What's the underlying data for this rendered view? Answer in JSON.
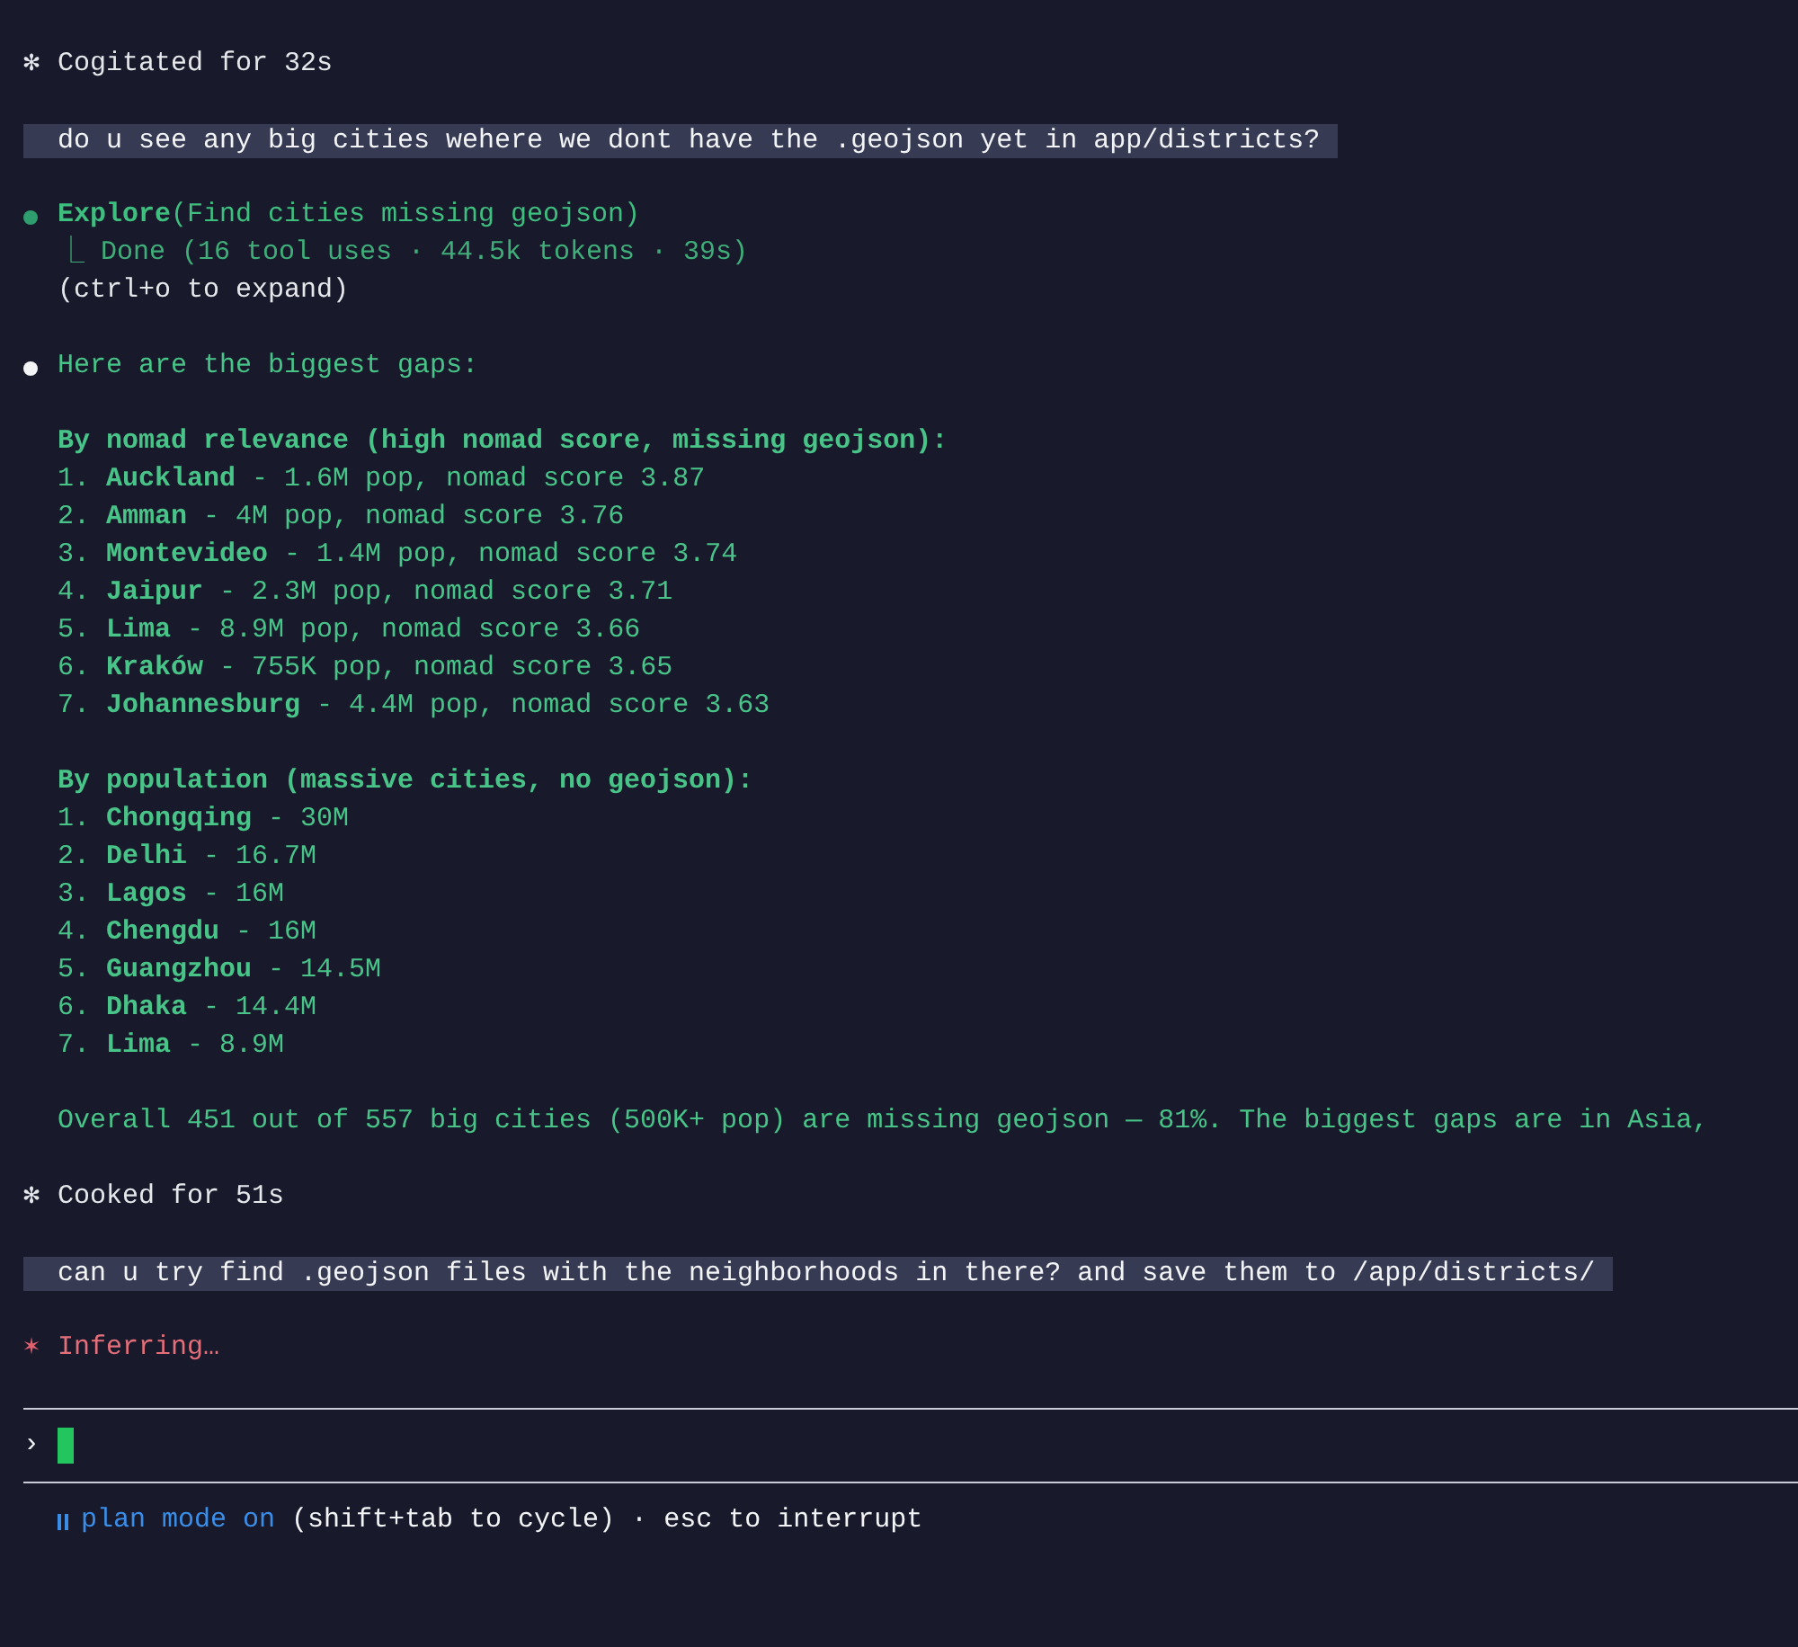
{
  "transcript": [
    {
      "kind": "status",
      "glyph": "✻",
      "text": "Cogitated for 32s"
    },
    {
      "kind": "user",
      "text": "do u see any big cities wehere we dont have the .geojson yet in app/districts?"
    },
    {
      "kind": "tool",
      "call": "**Explore**(Find cities missing geojson)",
      "result": "⎿  Done (16 tool uses · 44.5k tokens · 39s)",
      "hint": "(ctrl+o to expand)"
    },
    {
      "kind": "response",
      "intro": "Here are the biggest gaps:",
      "sections": [
        {
          "heading": "By nomad relevance (high nomad score, missing geojson):",
          "items": [
            "1. **Auckland** - 1.6M pop, nomad score 3.87",
            "2. **Amman** - 4M pop, nomad score 3.76",
            "3. **Montevideo** - 1.4M pop, nomad score 3.74",
            "4. **Jaipur** - 2.3M pop, nomad score 3.71",
            "5. **Lima** - 8.9M pop, nomad score 3.66",
            "6. **Kraków** - 755K pop, nomad score 3.65",
            "7. **Johannesburg** - 4.4M pop, nomad score 3.63"
          ]
        },
        {
          "heading": "By population (massive cities, no geojson):",
          "items": [
            "1. **Chongqing** - 30M",
            "2. **Delhi** - 16.7M",
            "3. **Lagos** - 16M",
            "4. **Chengdu** - 16M",
            "5. **Guangzhou** - 14.5M",
            "6. **Dhaka** - 14.4M",
            "7. **Lima** - 8.9M"
          ]
        }
      ],
      "summary": "Overall 451 out of 557 big cities (500K+ pop) are missing geojson — 81%. The biggest gaps are in Asia,"
    },
    {
      "kind": "status",
      "glyph": "✻",
      "text": "Cooked for 51s"
    },
    {
      "kind": "user",
      "text": "can u try find .geojson files with the neighborhoods in there? and save them to /app/districts/"
    },
    {
      "kind": "working",
      "glyph": "✶",
      "text": "Inferring…"
    }
  ],
  "prompt": {
    "glyph": "›"
  },
  "status_bar": {
    "mode": "plan mode on",
    "hint": "(shift+tab to cycle) · esc to interrupt"
  }
}
